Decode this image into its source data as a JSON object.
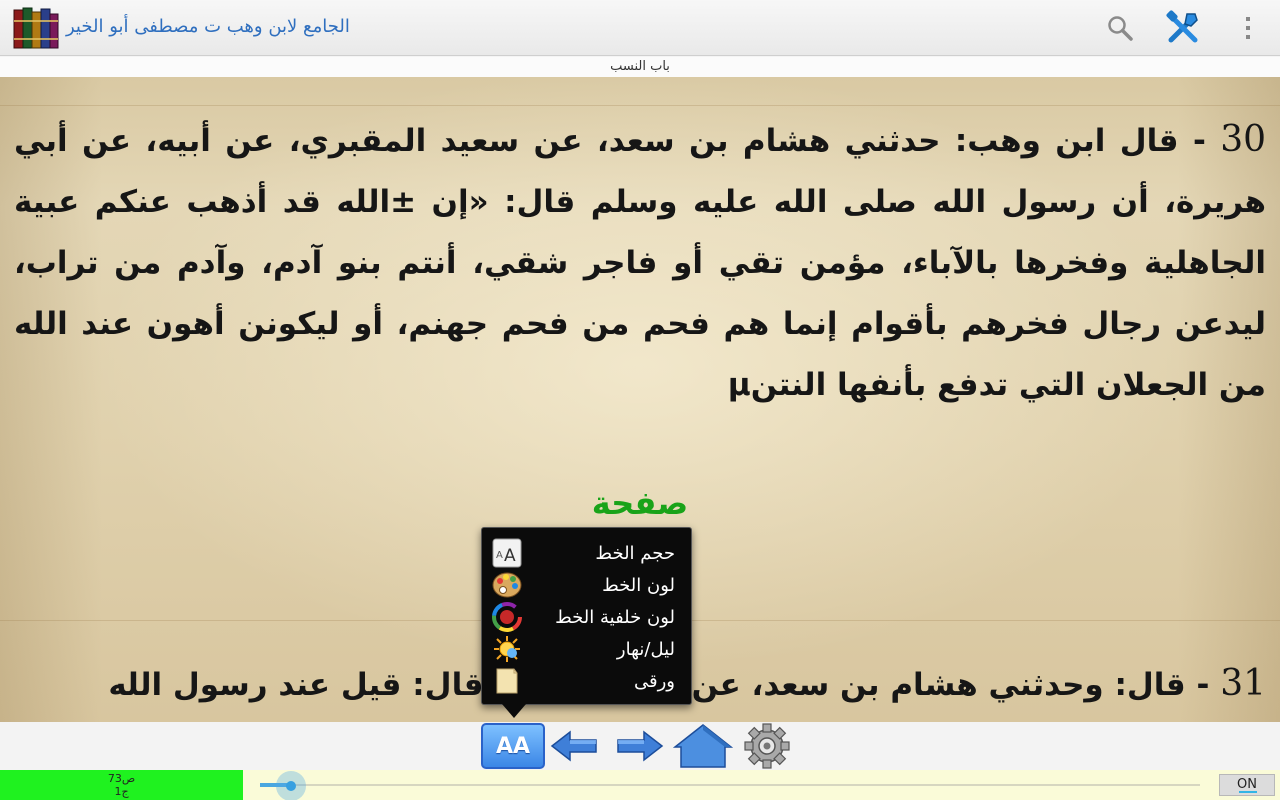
{
  "app": {
    "title": "الجامع لابن وهب ت مصطفى أبو الخير",
    "chapter": "باب النسب",
    "icons": {
      "app": "books-icon",
      "search": "search-icon",
      "tools": "tools-icon",
      "overflow": "overflow-menu-icon"
    }
  },
  "page": {
    "hadith_30": {
      "number": "30",
      "text": " - قال ابن وهب: حدثني هشام بن سعد، عن سعيد المقبري، عن أبيه، عن أبي هريرة، أن رسول الله صلى الله عليه وسلم قال: «إن ±الله قد أذهب عنكم عبية الجاهلية وفخرها بالآباء، مؤمن تقي أو فاجر شقي، أنتم بنو آدم، وآدم من تراب، ليدعن رجال فخرهم بأقوام إنما هم فحم من فحم جهنم، أو ليكونن أهون عند الله من الجعلان التي تدفع بأنفها النتنµ"
    },
    "page_label": "صفحة",
    "hadith_31": {
      "number": "31",
      "text": " - قال: وحدثني هشام بن سعد، عن زيد بن أسلم قال: قيل عند رسول الله"
    }
  },
  "menu": {
    "items": [
      {
        "label": "حجم الخط",
        "icon": "font-size-icon"
      },
      {
        "label": "لون الخط",
        "icon": "palette-icon"
      },
      {
        "label": "لون خلفية الخط",
        "icon": "color-wheel-icon"
      },
      {
        "label": "ليل/نهار",
        "icon": "sun-icon"
      },
      {
        "label": "ورقى",
        "icon": "paper-icon"
      }
    ]
  },
  "toolbar": {
    "font_button": "AA",
    "icons": [
      "font-style-icon",
      "back-arrow-icon",
      "forward-arrow-icon",
      "home-icon",
      "settings-gear-icon"
    ]
  },
  "status": {
    "page_line": "ص73",
    "part_line": "ج1",
    "toggle": "ON",
    "colors": {
      "page_indicator": "#1ff21f",
      "accent": "#33b5e5"
    }
  }
}
